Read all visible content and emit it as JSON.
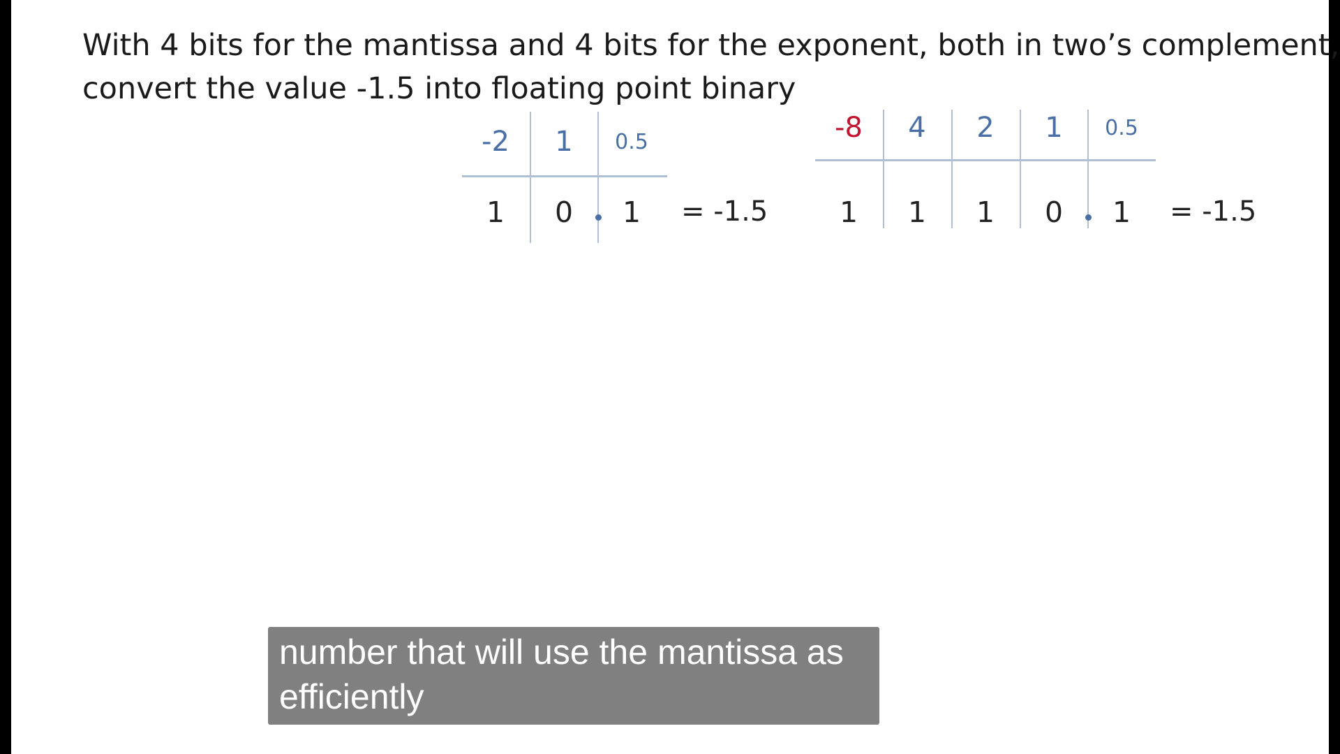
{
  "question": {
    "line1": "With 4 bits for the mantissa and 4 bits for the exponent, both in two’s complement,",
    "line2": "convert the value -1.5 into floating point binary"
  },
  "table_left": {
    "headers": [
      "-2",
      "1",
      "0.5"
    ],
    "bits": [
      "1",
      "0",
      "1"
    ],
    "result": "= -1.5"
  },
  "table_right": {
    "headers": [
      "-8",
      "4",
      "2",
      "1",
      "0.5"
    ],
    "bits": [
      "1",
      "1",
      "1",
      "0",
      "1"
    ],
    "result": "= -1.5"
  },
  "caption": {
    "line1": "number that will use the mantissa as",
    "line2": "efficiently"
  },
  "colors": {
    "header_blue": "#4a6fa5",
    "negative_header_red": "#c0142f",
    "caption_bg": "#6e6e6e"
  }
}
